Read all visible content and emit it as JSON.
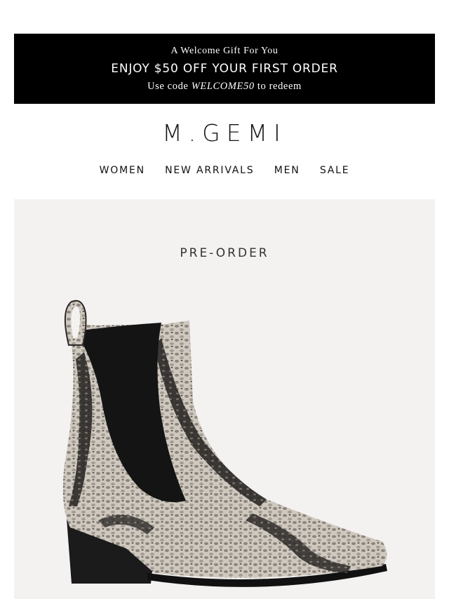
{
  "promo": {
    "line1": "A Welcome Gift For You",
    "line2": "ENJOY $50 OFF YOUR FIRST ORDER",
    "line3_prefix": "Use code ",
    "code": "WELCOME50",
    "line3_suffix": " to redeem"
  },
  "brand": {
    "logo": "M.GEMI"
  },
  "nav": {
    "items": [
      "WOMEN",
      "NEW ARRIVALS",
      "MEN",
      "SALE"
    ]
  },
  "hero": {
    "badge": "PRE-ORDER"
  },
  "colors": {
    "banner_bg": "#000000",
    "hero_bg": "#f4f2f0"
  },
  "icons": {
    "product": "snakeskin-chelsea-boot-image"
  }
}
